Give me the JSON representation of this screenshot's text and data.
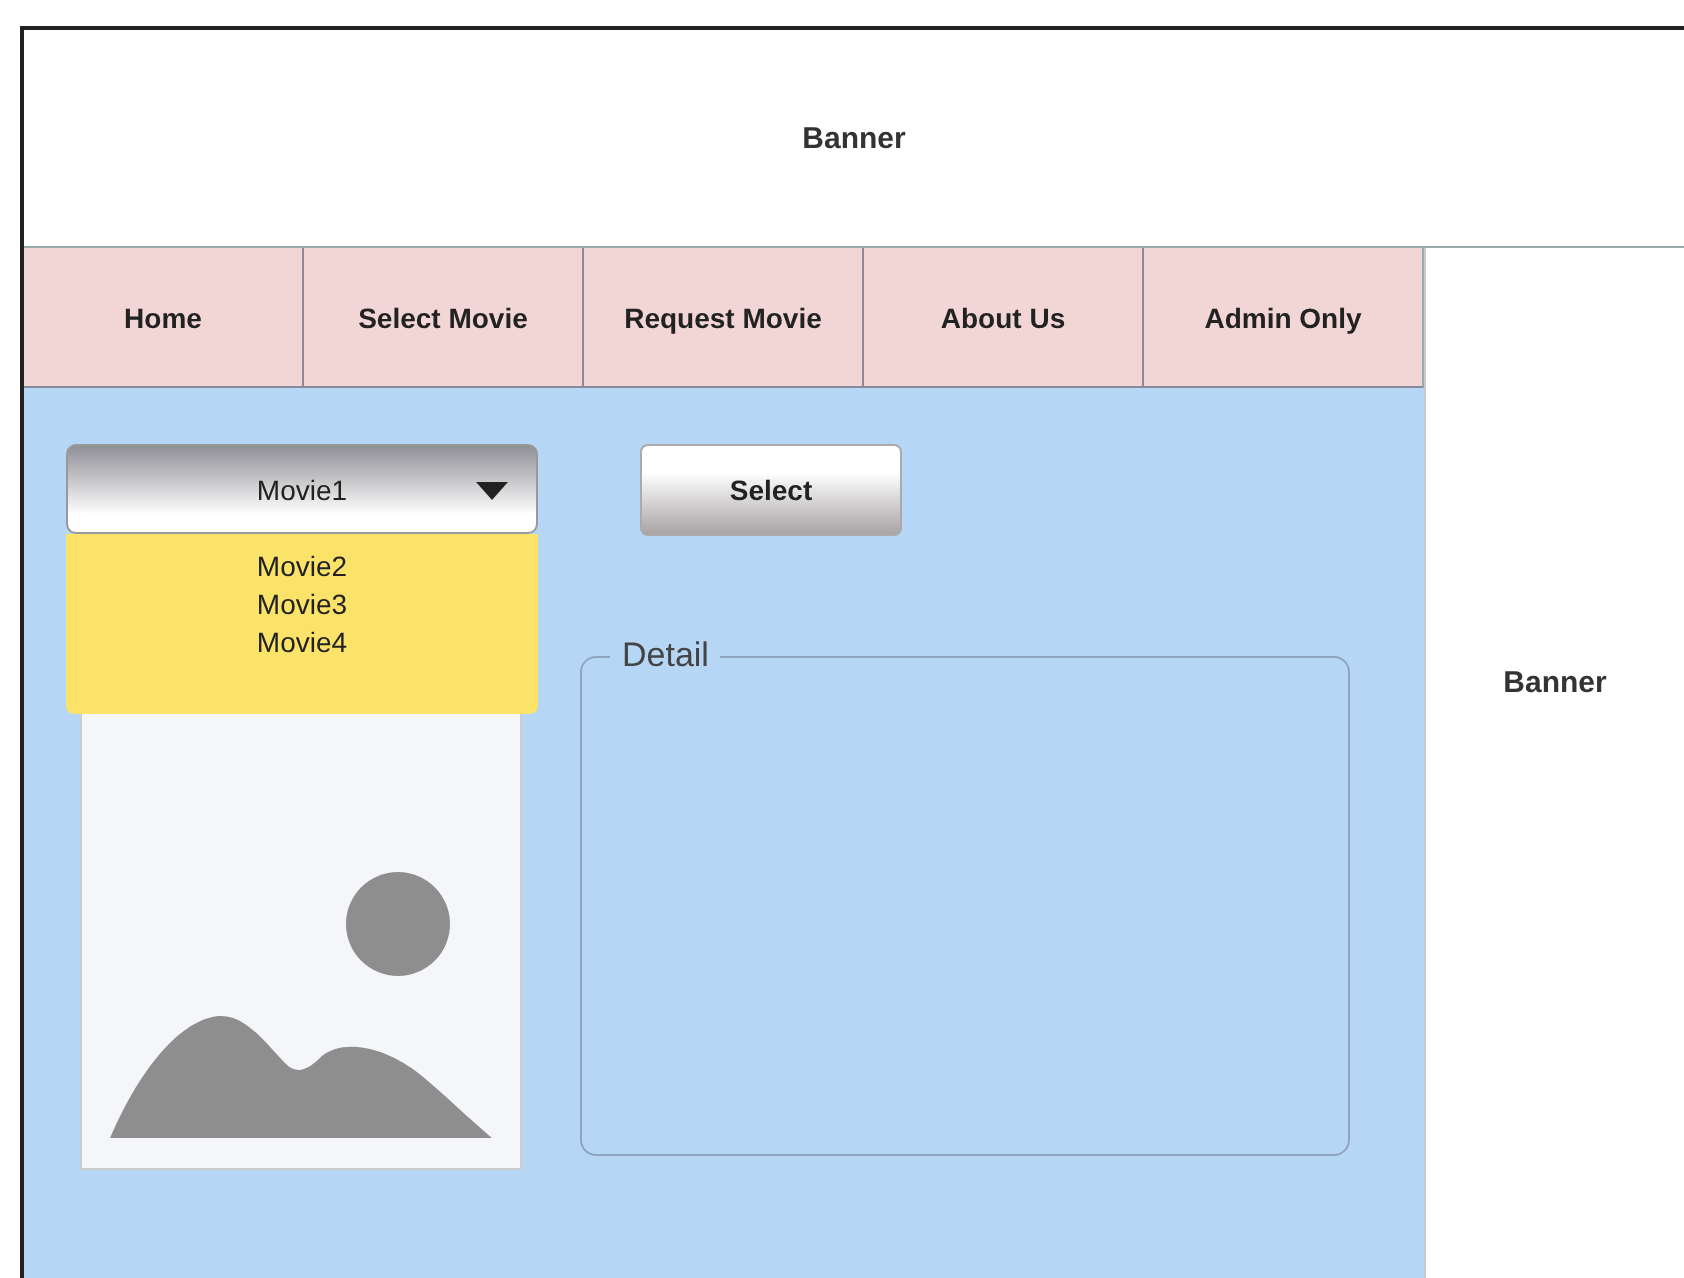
{
  "banner_top": {
    "label": "Banner"
  },
  "nav": [
    {
      "label": "Home"
    },
    {
      "label": "Select Movie"
    },
    {
      "label": "Request Movie"
    },
    {
      "label": "About Us"
    },
    {
      "label": "Admin Only"
    }
  ],
  "movie_dropdown": {
    "value": "Movie1",
    "expanded": true,
    "options": [
      "Movie2",
      "Movie3",
      "Movie4"
    ]
  },
  "select_button": {
    "label": "Select"
  },
  "detail": {
    "legend": "Detail"
  },
  "banner_side": {
    "label": "Banner"
  }
}
